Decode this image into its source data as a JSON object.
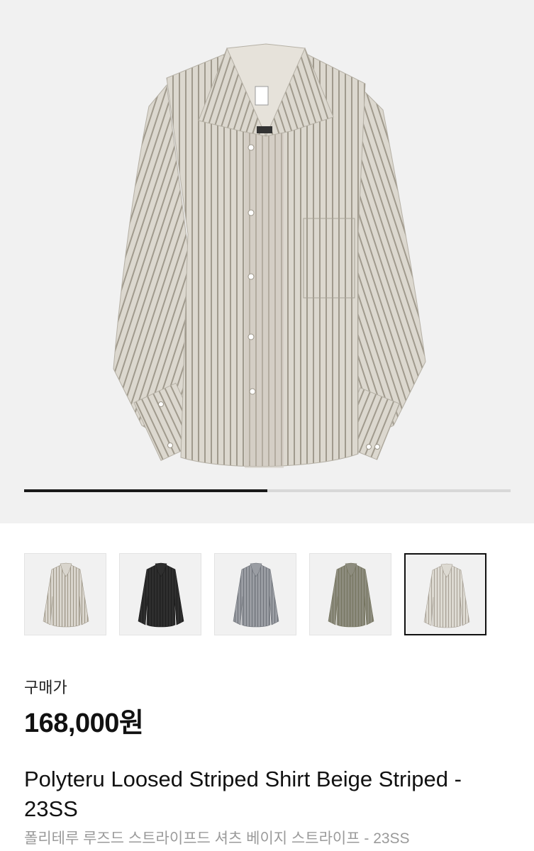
{
  "hero": {
    "image_name": "beige-striped-shirt-photo",
    "carousel_progress": 0.5
  },
  "thumbnails": [
    {
      "name": "thumb-beige-stripe",
      "color": "#d9d5cd",
      "stripe": "#9e9788",
      "selected": false
    },
    {
      "name": "thumb-black",
      "color": "#2e2e2e",
      "stripe": "#1e1e1e",
      "selected": false
    },
    {
      "name": "thumb-grey-stripe",
      "color": "#9a9da3",
      "stripe": "#6f737a",
      "selected": false
    },
    {
      "name": "thumb-khaki",
      "color": "#8d8c7e",
      "stripe": "#75745f",
      "selected": false
    },
    {
      "name": "thumb-beige-selected",
      "color": "#dddad2",
      "stripe": "#a7a095",
      "selected": true
    }
  ],
  "price": {
    "label": "구매가",
    "value": "168,000원"
  },
  "product": {
    "title": "Polyteru Loosed Striped Shirt Beige Striped - 23SS",
    "subtitle": "폴리테루 루즈드 스트라이프드 셔츠 베이지 스트라이프 - 23SS"
  },
  "colors": {
    "shirt_base": "#dcd8cf",
    "shirt_stripe": "#a09a8d",
    "progress_fill": "#1a1a1a",
    "progress_track": "#d8d8d8"
  }
}
